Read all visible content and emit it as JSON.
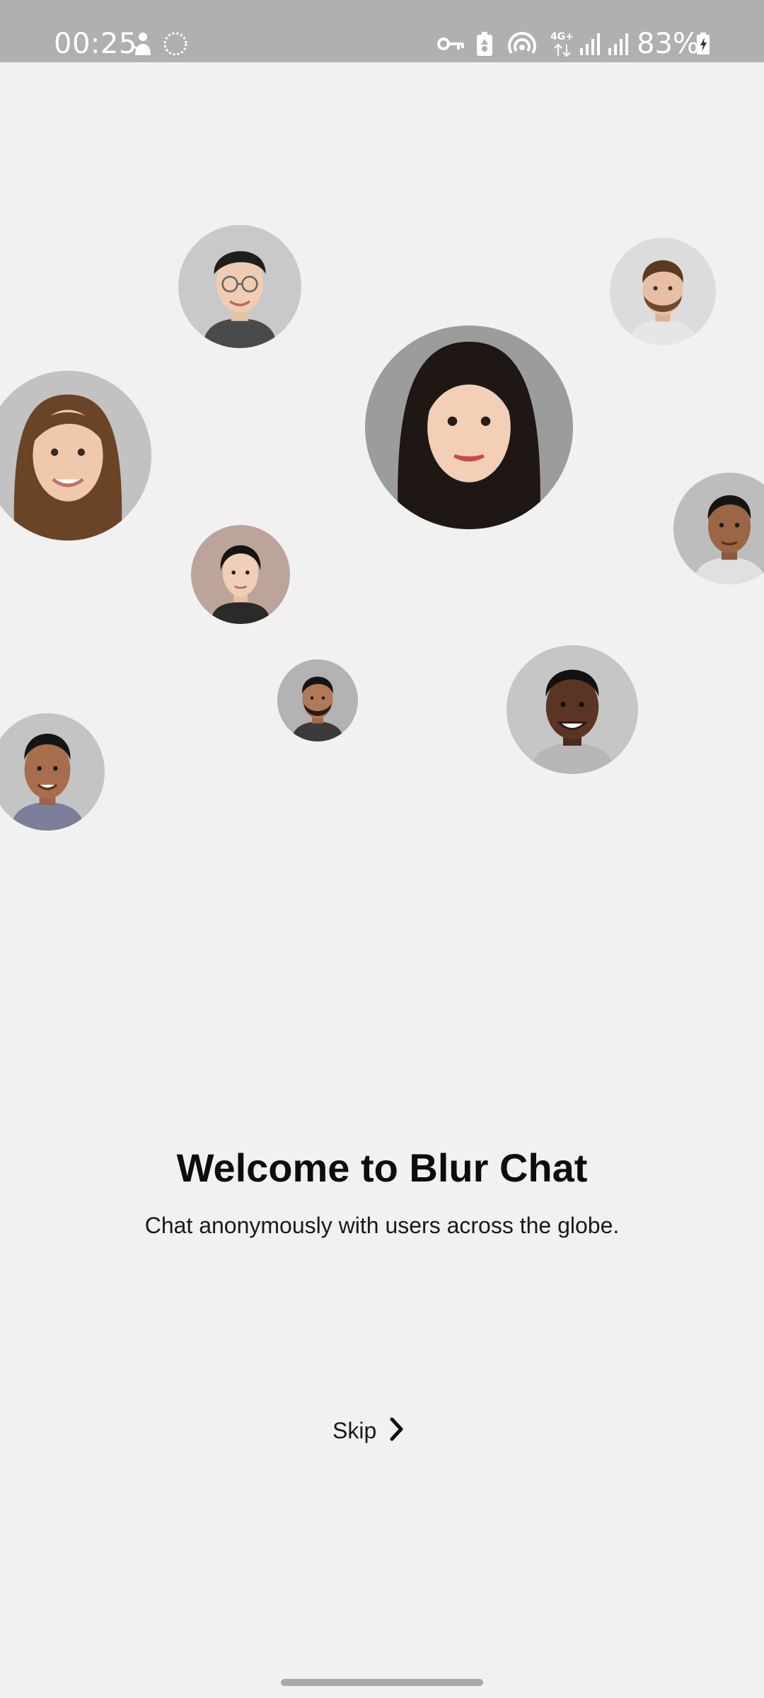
{
  "status_bar": {
    "time": "00:25",
    "network_type": "4G+",
    "battery_percent": "83%",
    "icons": [
      "notification-icon",
      "sync-icon",
      "vpn-key-icon",
      "battery-saver-icon",
      "hotspot-icon",
      "network-data-icon",
      "signal-icon",
      "signal-icon",
      "battery-charging-icon"
    ]
  },
  "avatars": [
    {
      "name": "avatar-man-glasses"
    },
    {
      "name": "avatar-man-beard"
    },
    {
      "name": "avatar-woman-brown-hair"
    },
    {
      "name": "avatar-woman-dark-hair"
    },
    {
      "name": "avatar-young-man-right"
    },
    {
      "name": "avatar-woman-short-hair"
    },
    {
      "name": "avatar-man-small-beard"
    },
    {
      "name": "avatar-man-smiling"
    },
    {
      "name": "avatar-man-left"
    }
  ],
  "onboarding": {
    "title": "Welcome to Blur Chat",
    "subtitle": "Chat anonymously with users across the globe."
  },
  "skip": {
    "label": "Skip"
  },
  "colors": {
    "background": "#f1f1f1",
    "status_bar": "#b0b0b0",
    "text": "#0d0d0d"
  }
}
